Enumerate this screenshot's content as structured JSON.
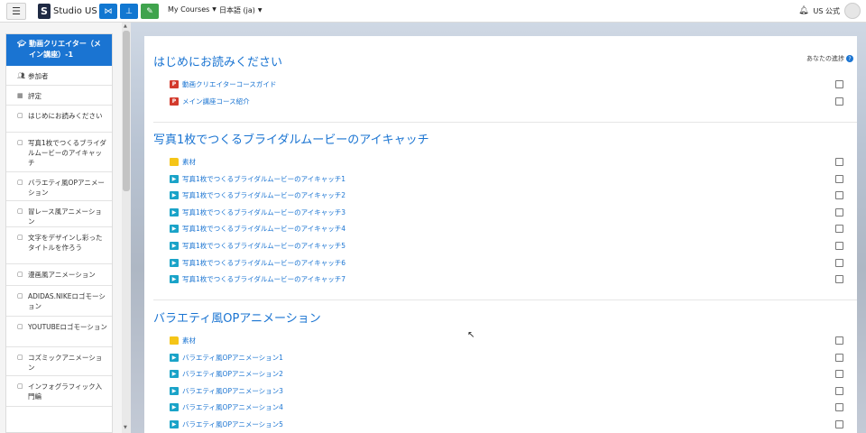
{
  "navbar": {
    "menu_icon": "hamburger-icon",
    "brand_logo_letter": "S",
    "brand_name": "Studio US",
    "my_courses": "My Courses",
    "language": "日本語 (ja)",
    "user_name": "US 公式"
  },
  "drawer": {
    "active_course": "動画クリエイター（メイン講座）-1",
    "items": [
      {
        "icon": "users-icon",
        "label": "参加者"
      },
      {
        "icon": "grades-icon",
        "label": "評定"
      },
      {
        "icon": "folder-icon",
        "label": "はじめにお読みください"
      },
      {
        "icon": "folder-icon",
        "label": "写真1枚でつくるブライダルムービーのアイキャッチ"
      },
      {
        "icon": "folder-icon",
        "label": "バラエティ風OPアニメーション"
      },
      {
        "icon": "folder-icon",
        "label": "冒レース風アニメーション"
      },
      {
        "icon": "folder-icon",
        "label": "文字をデザインし彩ったタイトルを作ろう"
      },
      {
        "icon": "folder-icon",
        "label": "漫画風アニメーション"
      },
      {
        "icon": "folder-icon",
        "label": "ADIDAS.NIKEロゴモーション"
      },
      {
        "icon": "folder-icon",
        "label": "YOUTUBEロゴモーション"
      },
      {
        "icon": "folder-icon",
        "label": "コズミックアニメーション"
      },
      {
        "icon": "folder-icon",
        "label": "インフォグラフィック入門編"
      }
    ]
  },
  "content": {
    "progress_label": "あなたの進捗",
    "sections": [
      {
        "title": "はじめにお読みください",
        "activities": [
          {
            "type": "pdf",
            "label": "動画クリエイターコースガイド"
          },
          {
            "type": "pdf",
            "label": "メイン講座コース紹介"
          }
        ]
      },
      {
        "title": "写真1枚でつくるブライダルムービーのアイキャッチ",
        "activities": [
          {
            "type": "folder",
            "label": "素材"
          },
          {
            "type": "video",
            "label": "写真1枚でつくるブライダルムービーのアイキャッチ1"
          },
          {
            "type": "video",
            "label": "写真1枚でつくるブライダルムービーのアイキャッチ2"
          },
          {
            "type": "video",
            "label": "写真1枚でつくるブライダルムービーのアイキャッチ3"
          },
          {
            "type": "video",
            "label": "写真1枚でつくるブライダルムービーのアイキャッチ4"
          },
          {
            "type": "video",
            "label": "写真1枚でつくるブライダルムービーのアイキャッチ5"
          },
          {
            "type": "video",
            "label": "写真1枚でつくるブライダルムービーのアイキャッチ6"
          },
          {
            "type": "video",
            "label": "写真1枚でつくるブライダルムービーのアイキャッチ7"
          }
        ]
      },
      {
        "title": "バラエティ風OPアニメーション",
        "activities": [
          {
            "type": "folder",
            "label": "素材"
          },
          {
            "type": "video",
            "label": "バラエティ風OPアニメーション1"
          },
          {
            "type": "video",
            "label": "バラエティ風OPアニメーション2"
          },
          {
            "type": "video",
            "label": "バラエティ風OPアニメーション3"
          },
          {
            "type": "video",
            "label": "バラエティ風OPアニメーション4"
          },
          {
            "type": "video",
            "label": "バラエティ風OPアニメーション5"
          }
        ]
      }
    ]
  }
}
